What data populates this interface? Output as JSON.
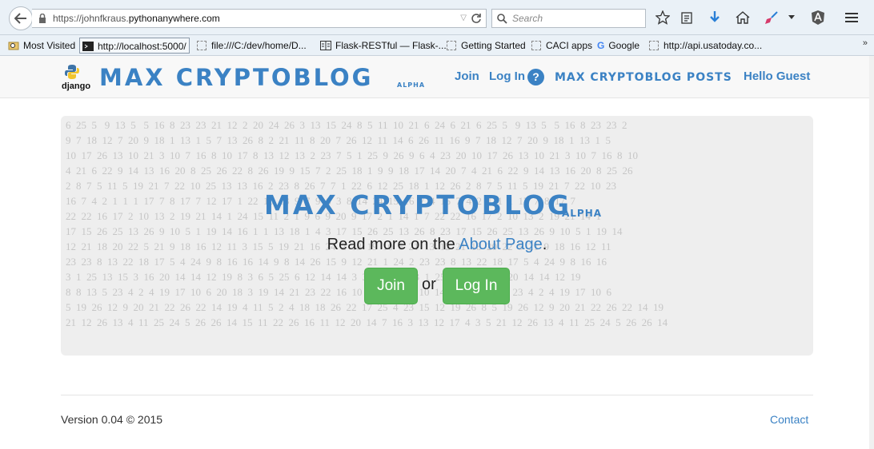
{
  "browser": {
    "url_prefix": "https://johnfkraus.",
    "url_domain": "pythonanywhere.com",
    "search_placeholder": "Search",
    "bookmarks": [
      {
        "label": "Most Visited"
      },
      {
        "label": "http://localhost:5000/"
      },
      {
        "label": "file:///C:/dev/home/D..."
      },
      {
        "label": "Flask-RESTful — Flask-..."
      },
      {
        "label": "Getting Started"
      },
      {
        "label": "CACI apps"
      },
      {
        "label": "Google"
      },
      {
        "label": "http://api.usatoday.co..."
      }
    ],
    "bookmarks_more": "»"
  },
  "header": {
    "logo_text": "django",
    "brand": "MAX CRYPTOBLOG",
    "brand_suffix": "ALPHA",
    "nav": {
      "join": "Join",
      "login": "Log In",
      "help": "?",
      "posts": "MAX CRYPTOBLOG POSTS",
      "greeting": "Hello Guest"
    }
  },
  "hero": {
    "title": "MAX CRYPTOBLOG",
    "title_suffix": "ALPHA",
    "tagline_before": "Read more on the ",
    "tagline_link": "About Page",
    "tagline_after": ".",
    "join_button": "Join",
    "or_text": "or",
    "login_button": "Log In",
    "background_rows": [
      "6  25  5   9  13  5   5  16  8  23  23  21  12  2  20  24  26  3  13  15  24  8  5  11  10  21  6  24  6  21  6  25  5   9  13  5   5  16  8  23  23  2",
      "9  7  18  12  7  20  9  18  1  13  1  5  7  13  26  8  2  21  11  8  20  7  26  12  11  14  6  26  11  16  9  7  18  12  7  20  9  18  1  13  1  5",
      "10  17  26  13  10  21  3  10  7  16  8  10  17  8  13  12  13  2  23  7  5  1  25  9  26  9  6  4  23  20  10  17  26  13  10  21  3  10  7  16  8  10",
      "4  21  6  22  9  14  13  16  20  8  25  26  22  8  26  19  9  15  7  2  25  18  1  9  9  18  17  14  20  7  4  21  6  22  9  14  13  16  20  8  25  26",
      "2  8  7  5  11  5  19  21  7  22  10  25  13  13  16  2  23  8  26  7  7  1  22  6  12  25  18  1  12  26  2  8  7  5  11  5  19  21  7  22  10  23",
      "16  7  4  2  1  1  1  17  7  8  17  7  12  17  1  22  10  13  9  7  9  6  3  8  14  24  15  16  7  4  16  7  4  2  1  1  1  17  7  8  17  7",
      "22  22  16  17  2  10  13  2  19  21  14  1  24  15  11  2  1  9  6  9  20  9  17  2  1  14  1  7  22  22  16  17  2  10  13  2  19  21  14  1",
      "17  15  26  25  13  26  9  10  5  1  19  14  16  1  1  13  18  1  4  3  17  15  26  25  13  26  8  23  17  15  26  25  13  26  9  10  5  1  19  14",
      "12  21  18  20  22  5  21  9  18  16  12  11  3  15  5  19  21  16  24  2  13  19  10  6  21  13  12  21  18  20  22  5  21  9  18  16  12  11",
      "23  23  8  13  22  18  17  5  4  24  9  8  16  16  14  9  8  14  26  15  9  12  21  1  24  2  23  23  8  13  22  18  17  5  4  24  9  8  16  16",
      "3  1  25  13  15  3  16  20  14  14  12  19  8  3  6  5  25  6  12  14  14  3  3  5  18  22  3  1  25  13  15  3  16  20  14  14  12  19",
      "8  8  13  5  23  4  2  4  19  17  10  6  20  18  3  19  14  21  23  22  16  10  8  11  25  4  10  14  14  8  8  13  5  23  4  2  4  19  17  10  6",
      "5  19  26  12  9  20  21  22  26  22  14  19  4  11  5  2  4  18  18  26  22  17  25  4  23  15  12  19  26  8  5  19  26  12  9  20  21  22  26  22  14  19",
      "21  12  26  13  4  11  25  24  5  26  26  14  15  11  22  26  16  11  12  20  14  7  16  3  13  12  17  4  3  5  21  12  26  13  4  11  25  24  5  26  26  14"
    ]
  },
  "footer": {
    "version": "Version 0.04 © 2015",
    "contact": "Contact"
  },
  "colors": {
    "brand_blue": "#3b82c4",
    "button_green": "#5cb85c"
  }
}
